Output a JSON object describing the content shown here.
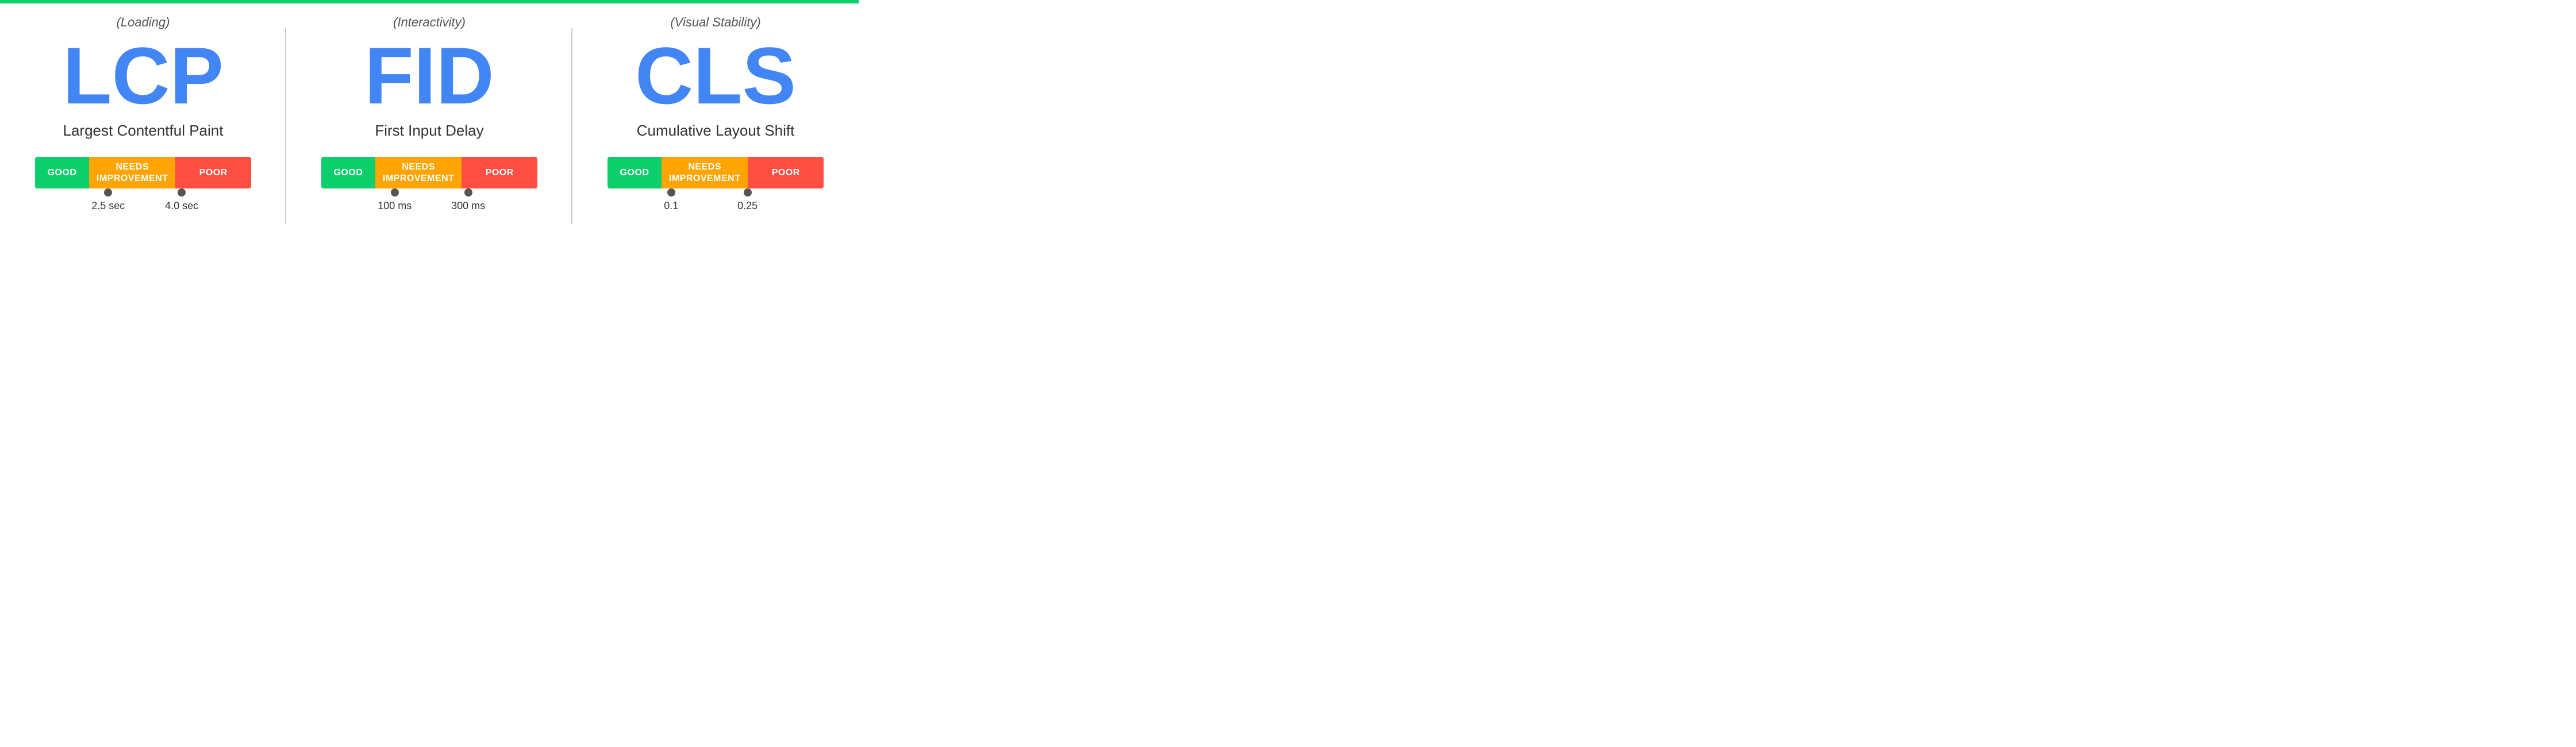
{
  "top_bar_color": "#0cce6b",
  "panels": [
    {
      "id": "lcp",
      "category": "(Loading)",
      "acronym": "LCP",
      "full_name": "Largest Contentful Paint",
      "segments": [
        {
          "label": "GOOD",
          "class": "seg-good"
        },
        {
          "label": "NEEDS\nIMPROVEMENT",
          "class": "seg-needs"
        },
        {
          "label": "POOR",
          "class": "seg-poor"
        }
      ],
      "markers": [
        {
          "label": "2.5 sec",
          "position_pct": 28
        },
        {
          "label": "4.0 sec",
          "position_pct": 62
        }
      ]
    },
    {
      "id": "fid",
      "category": "(Interactivity)",
      "acronym": "FID",
      "full_name": "First Input Delay",
      "segments": [
        {
          "label": "GOOD",
          "class": "seg-good"
        },
        {
          "label": "NEEDS\nIMPROVEMENT",
          "class": "seg-needs"
        },
        {
          "label": "POOR",
          "class": "seg-poor"
        }
      ],
      "markers": [
        {
          "label": "100 ms",
          "position_pct": 28
        },
        {
          "label": "300 ms",
          "position_pct": 62
        }
      ]
    },
    {
      "id": "cls",
      "category": "(Visual Stability)",
      "acronym": "CLS",
      "full_name": "Cumulative Layout Shift",
      "segments": [
        {
          "label": "GOOD",
          "class": "seg-good"
        },
        {
          "label": "NEEDS\nIMPROVEMENT",
          "class": "seg-needs"
        },
        {
          "label": "POOR",
          "class": "seg-poor"
        }
      ],
      "markers": [
        {
          "label": "0.1",
          "position_pct": 28
        },
        {
          "label": "0.25",
          "position_pct": 62
        }
      ]
    }
  ]
}
